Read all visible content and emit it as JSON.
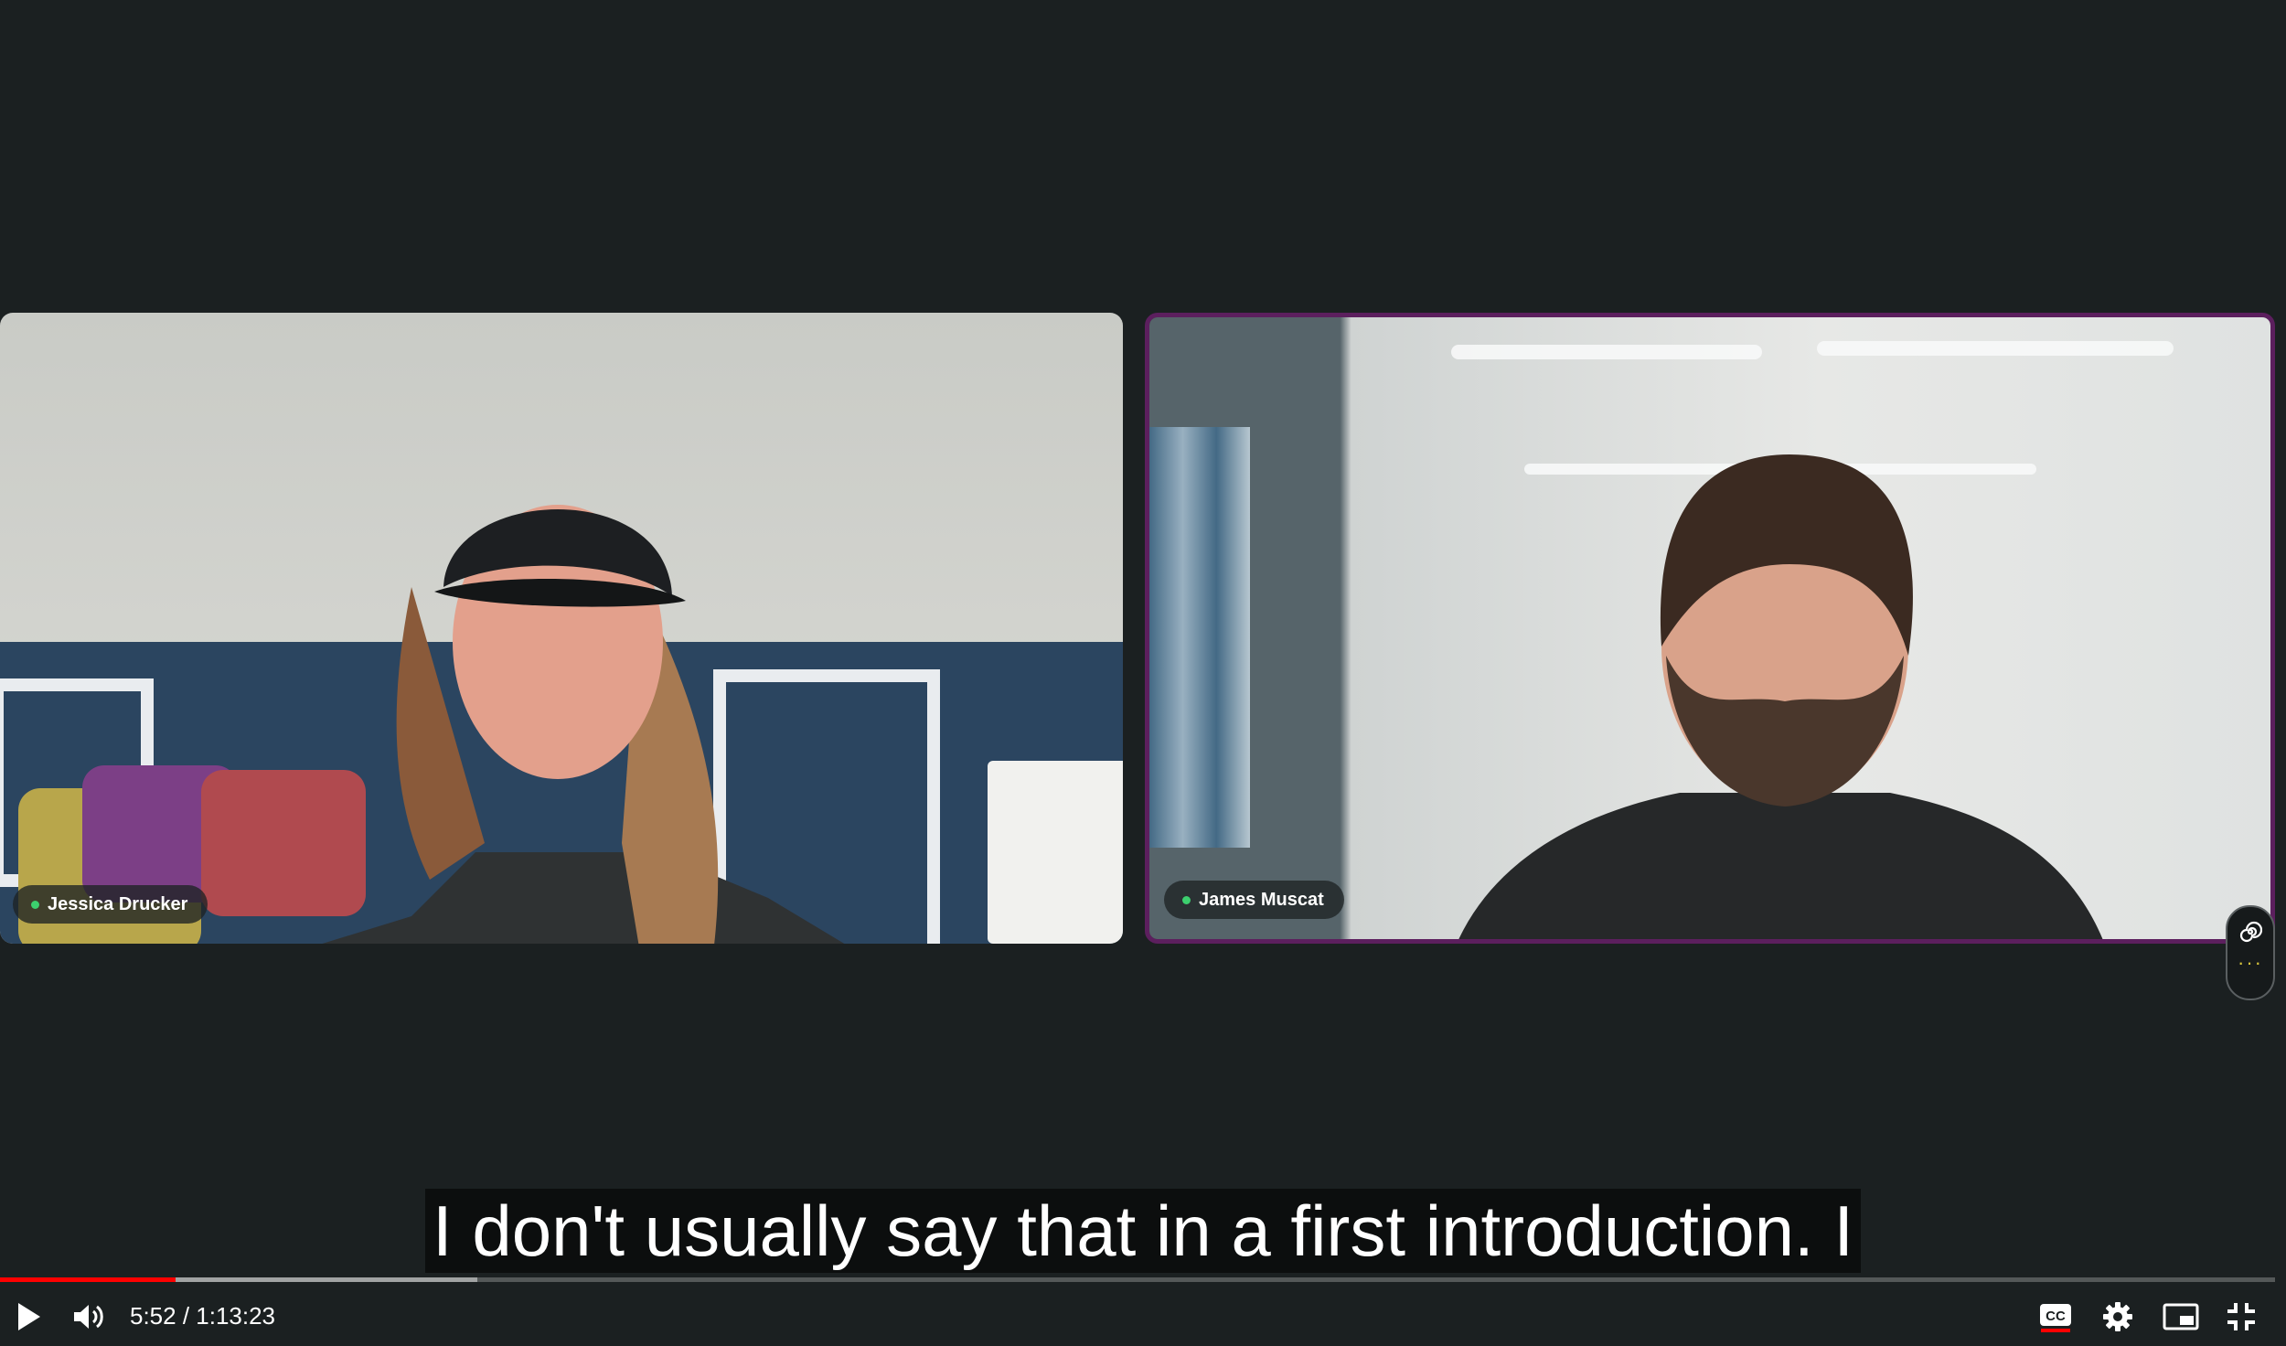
{
  "participants": [
    {
      "name": "Jessica Drucker"
    },
    {
      "name": "James Muscat"
    }
  ],
  "caption": "I don't usually say that in a first introduction. I",
  "player": {
    "current_time": "5:52",
    "duration": "1:13:23",
    "time_display": "5:52 / 1:13:23",
    "progress_fraction": 0.077,
    "buffered_fraction": 0.21,
    "captions_enabled": true
  },
  "colors": {
    "background": "#1b2021",
    "active_speaker_border": "#5c1f5e",
    "progress": "#ff0000",
    "status_dot": "#3ccf6e"
  },
  "icons": [
    "play-icon",
    "volume-icon",
    "closed-captions-icon",
    "settings-gear-icon",
    "miniplayer-icon",
    "exit-fullscreen-icon",
    "spiral-icon",
    "more-dots-icon"
  ]
}
